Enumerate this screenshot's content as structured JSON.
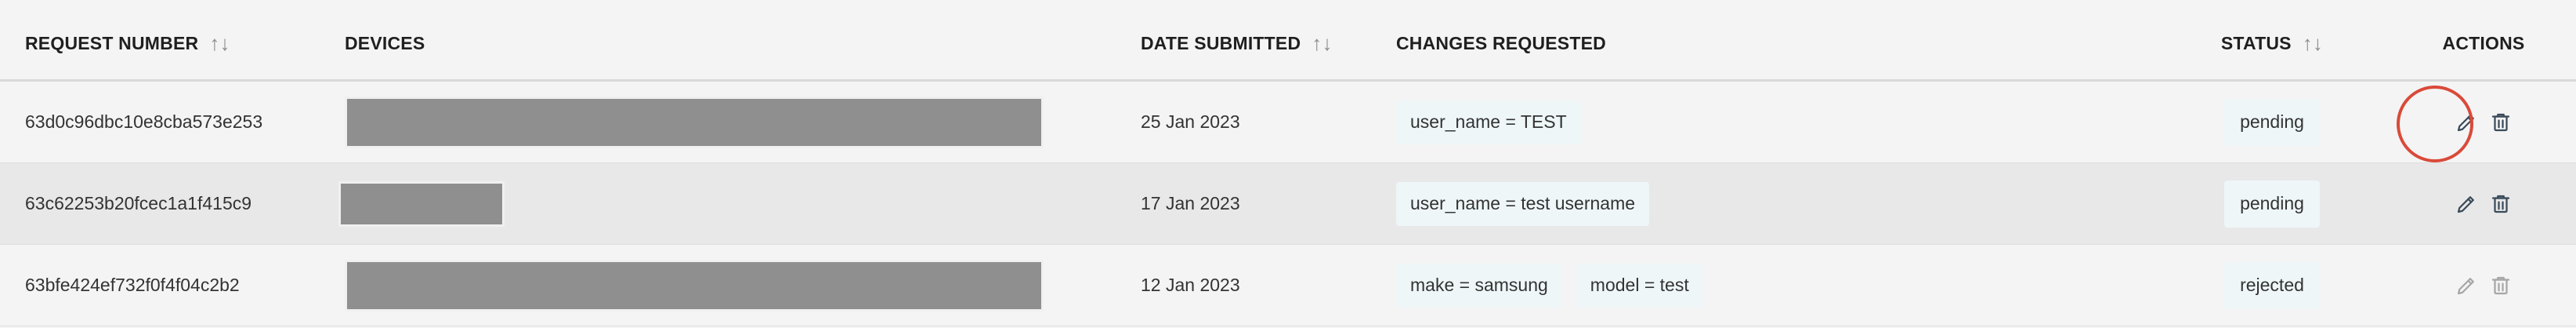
{
  "table": {
    "headers": {
      "request_number": "REQUEST NUMBER",
      "devices": "DEVICES",
      "date_submitted": "DATE SUBMITTED",
      "changes_requested": "CHANGES REQUESTED",
      "status": "STATUS",
      "actions": "ACTIONS"
    },
    "sort_icon": "↑↓",
    "rows": [
      {
        "request_number": "63d0c96dbc10e8cba573e253",
        "date_submitted": "25 Jan 2023",
        "changes": [
          "user_name = TEST"
        ],
        "status": "pending"
      },
      {
        "request_number": "63c62253b20fcec1a1f415c9",
        "date_submitted": "17 Jan 2023",
        "changes": [
          "user_name = test username"
        ],
        "status": "pending"
      },
      {
        "request_number": "63bfe424ef732f0f4f04c2b2",
        "date_submitted": "12 Jan 2023",
        "changes": [
          "make = samsung",
          "model = test"
        ],
        "status": "rejected"
      }
    ]
  },
  "colors": {
    "background": "#f4f4f4",
    "row_alt": "#e8e8e8",
    "chip_bg": "#eef6f8",
    "redacted": "#8f8f8f",
    "highlight": "#d94a3a"
  },
  "icons": {
    "edit": "pencil-icon",
    "delete": "trash-icon"
  }
}
